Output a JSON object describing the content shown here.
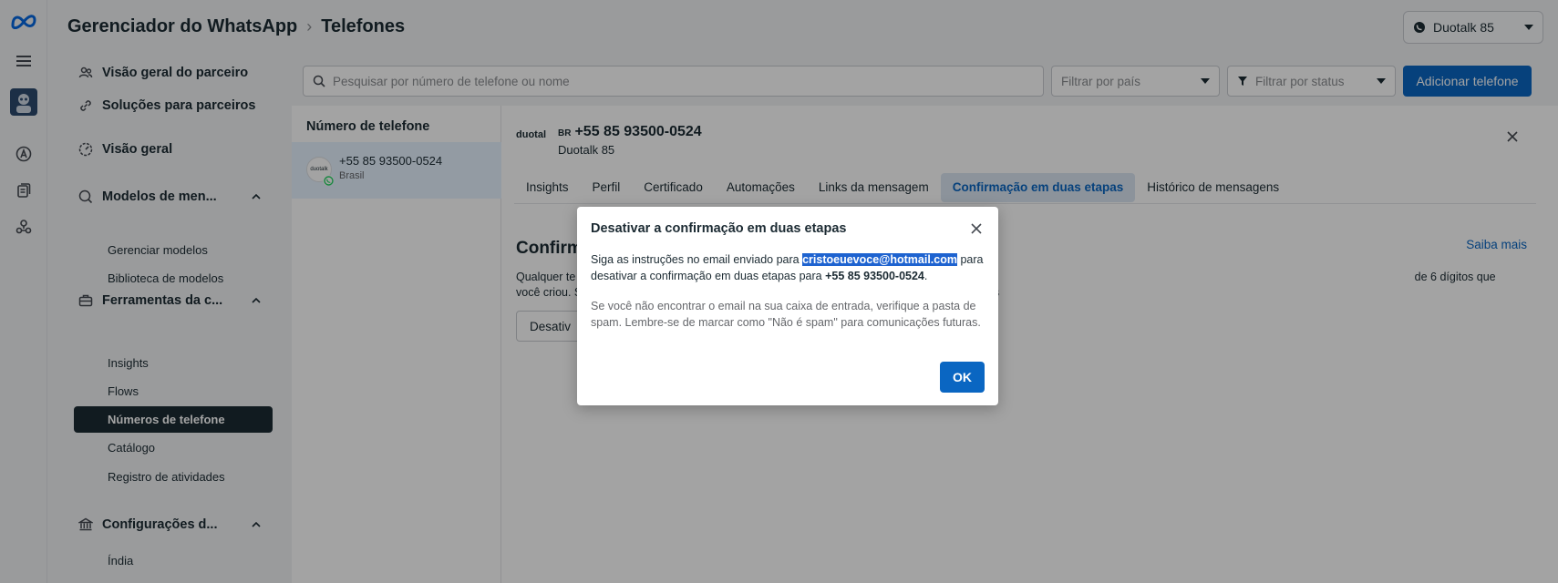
{
  "header": {
    "app_title": "Gerenciador do WhatsApp",
    "page_title": "Telefones",
    "account_name": "Duotalk 85"
  },
  "sidebar": {
    "items": [
      {
        "label": "Visão geral do parceiro"
      },
      {
        "label": "Soluções para parceiros"
      },
      {
        "label": "Visão geral"
      },
      {
        "label": "Modelos de men..."
      },
      {
        "label": "Gerenciar modelos"
      },
      {
        "label": "Biblioteca de modelos"
      },
      {
        "label": "Ferramentas da c..."
      },
      {
        "label": "Insights"
      },
      {
        "label": "Flows"
      },
      {
        "label": "Números de telefone"
      },
      {
        "label": "Catálogo"
      },
      {
        "label": "Registro de atividades"
      },
      {
        "label": "Configurações d..."
      },
      {
        "label": "Índia"
      }
    ]
  },
  "toolbar": {
    "search_placeholder": "Pesquisar por número de telefone ou nome",
    "country_filter": "Filtrar por país",
    "status_filter": "Filtrar por status",
    "add_phone": "Adicionar telefone"
  },
  "list": {
    "header": "Número de telefone",
    "rows": [
      {
        "phone": "+55 85 93500-0524",
        "country": "Brasil",
        "avatar_text": "duotalk"
      }
    ]
  },
  "detail": {
    "logo_text": "duotal",
    "country_code": "BR",
    "phone": "+55 85 93500-0524",
    "name": "Duotalk 85",
    "tabs": [
      {
        "label": "Insights"
      },
      {
        "label": "Perfil"
      },
      {
        "label": "Certificado"
      },
      {
        "label": "Automações"
      },
      {
        "label": "Links da mensagem"
      },
      {
        "label": "Confirmação em duas etapas"
      },
      {
        "label": "Histórico de mensagens"
      }
    ],
    "section_title": "Confirm",
    "learn_more": "Saiba mais",
    "description": "Qualquer te                                                                                                                                                                                                                                                                         de 6 dígitos que você criou. Se você esquecer ou perder o PIN, poderá desativar a confirmação em duas etapas",
    "disable_button": "Desativ"
  },
  "modal": {
    "title": "Desativar a confirmação em duas etapas",
    "text_before": "Siga as instruções no email enviado para ",
    "email": "cristoeuevoce@hotmail.com",
    "text_after": " para desativar a confirmação em duas etapas para ",
    "phone": "+55 85 93500-0524",
    "period": ".",
    "note": "Se você não encontrar o email na sua caixa de entrada, verifique a pasta de spam. Lembre-se de marcar como \"Não é spam\" para comunicações futuras.",
    "ok_label": "OK"
  },
  "colors": {
    "primary": "#0a66c2",
    "active_nav": "#1c2b33",
    "selection": "#1e63d0",
    "meta_blue": "#0668e1",
    "whatsapp_green": "#25d366"
  }
}
